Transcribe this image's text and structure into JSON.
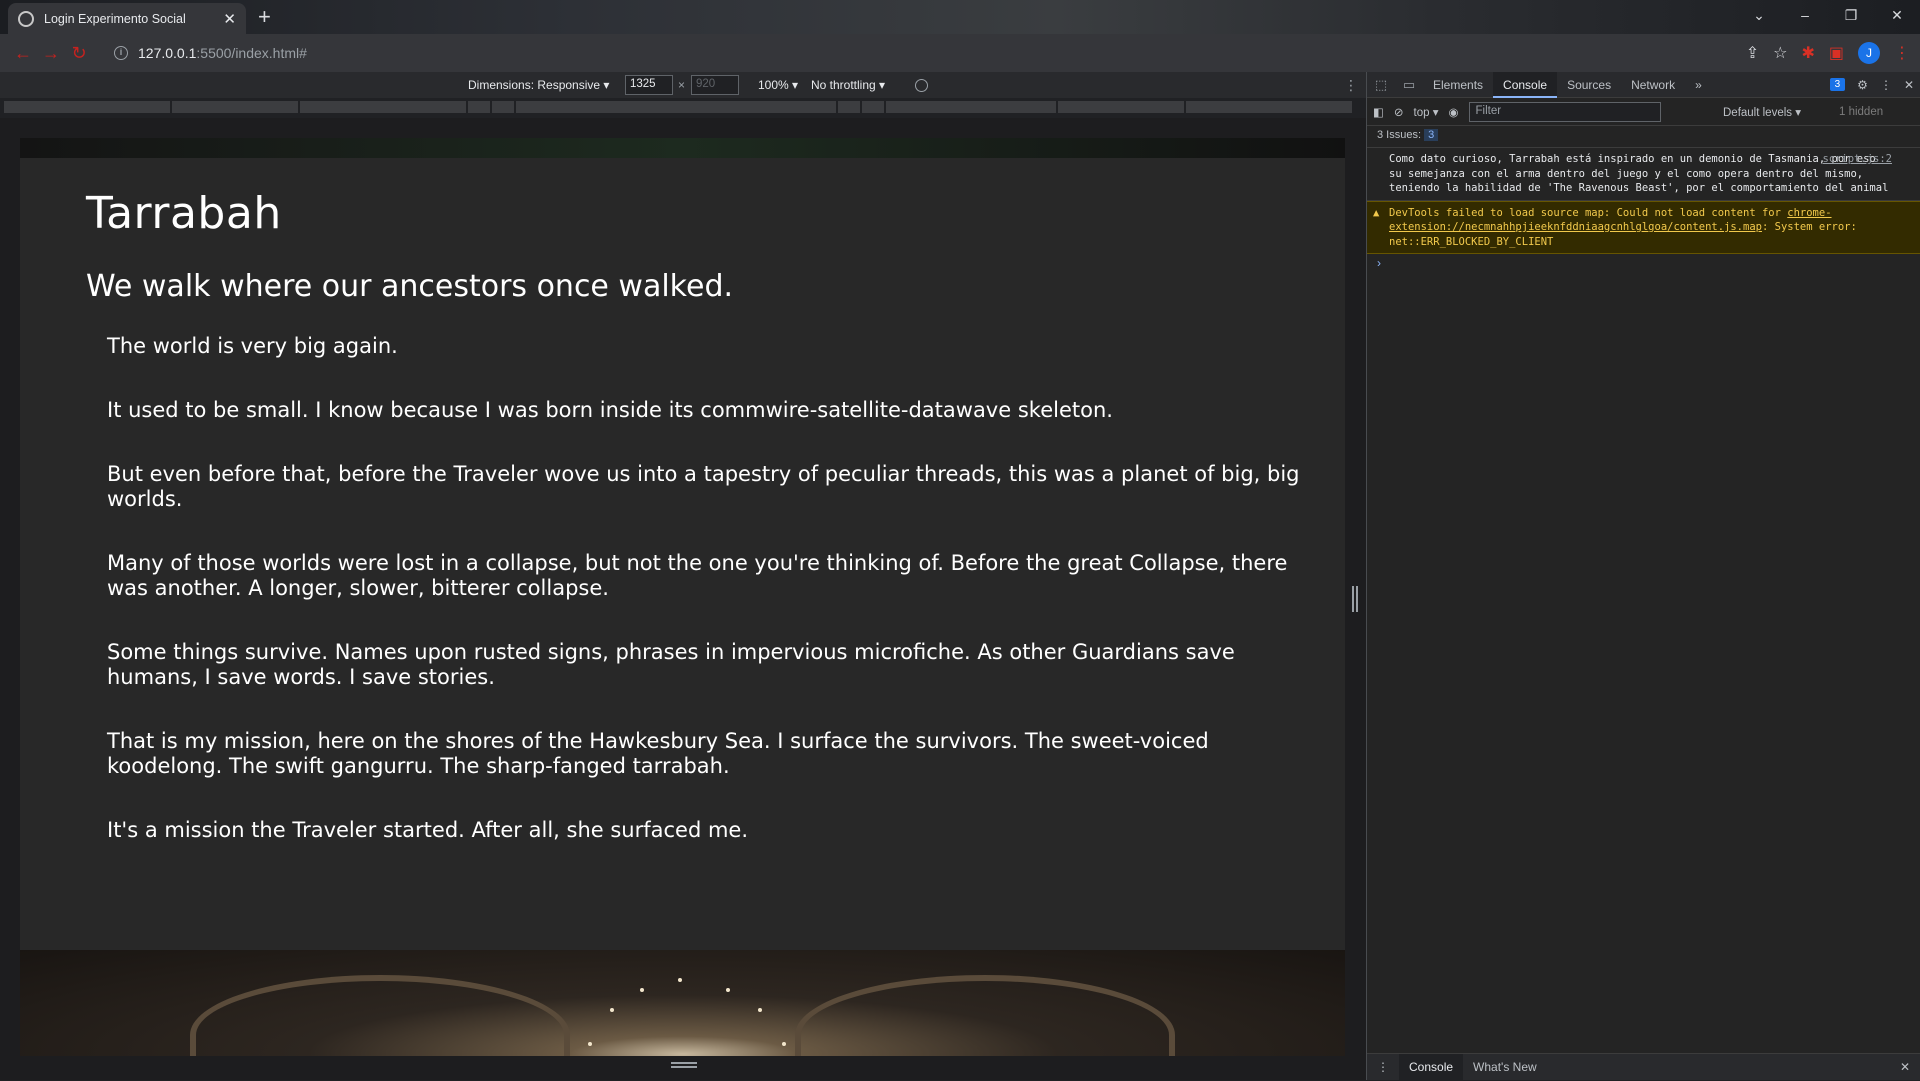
{
  "browser": {
    "tab_title": "Login Experimento Social",
    "tab_close": "✕",
    "new_tab": "+",
    "url_host": "127.0.0.1",
    "url_path": ":5500/index.html#",
    "window_controls": [
      "⌄",
      "–",
      "❐",
      "✕"
    ]
  },
  "device_toolbar": {
    "dimensions": "Dimensions: Responsive ▾",
    "width": "1325",
    "height_placeholder": "920",
    "times": "×",
    "zoom": "100% ▾",
    "throttling": "No throttling ▾"
  },
  "page": {
    "title": "Tarrabah",
    "subtitle": "We walk where our ancestors once walked.",
    "paragraphs": [
      "The world is very big again.",
      "It used to be small. I know because I was born inside its commwire-satellite-datawave skeleton.",
      "But even before that, before the Traveler wove us into a tapestry of peculiar threads, this was a planet of big, big worlds.",
      "Many of those worlds were lost in a collapse, but not the one you're thinking of. Before the great Collapse, there was another. A longer, slower, bitterer collapse.",
      "Some things survive. Names upon rusted signs, phrases in impervious microfiche. As other Guardians save humans, I save words. I save stories.",
      "That is my mission, here on the shores of the Hawkesbury Sea. I surface the survivors. The sweet-voiced koodelong. The swift gangurru. The sharp-fanged tarrabah.",
      "It's a mission the Traveler started. After all, she surfaced me."
    ]
  },
  "devtools": {
    "tabs": [
      "Elements",
      "Console",
      "Sources",
      "Network"
    ],
    "active_tab": "Console",
    "more_tabs": "»",
    "issues_badge": "3",
    "context": "top ▾",
    "filter_placeholder": "Filter",
    "levels": "Default levels ▾",
    "hidden": "1 hidden",
    "issues_label": "3 Issues:",
    "issues_count": "3",
    "log_message": "Como dato curioso, Tarrabah está inspirado en un demonio de Tasmania, por eso su semejanza con el arma dentro del juego y el como opera dentro del mismo, teniendo la habilidad de 'The Ravenous Beast', por el comportamiento del animal",
    "log_source": "script.js:2",
    "warn_prefix": "DevTools failed to load source map: Could not load content for ",
    "warn_link": "chrome-extension://necmnahhpjieeknfddniaagcnhlglgoa/content.js.map",
    "warn_suffix": ": System error: net::ERR_BLOCKED_BY_CLIENT",
    "prompt": "›",
    "drawer_tabs": [
      "Console",
      "What's New"
    ],
    "drawer_close": "✕"
  },
  "colors": {
    "page_bg": "#282828",
    "devtools_bg": "#242424",
    "warn_bg": "#332b00",
    "accent": "#8ab4f8"
  }
}
